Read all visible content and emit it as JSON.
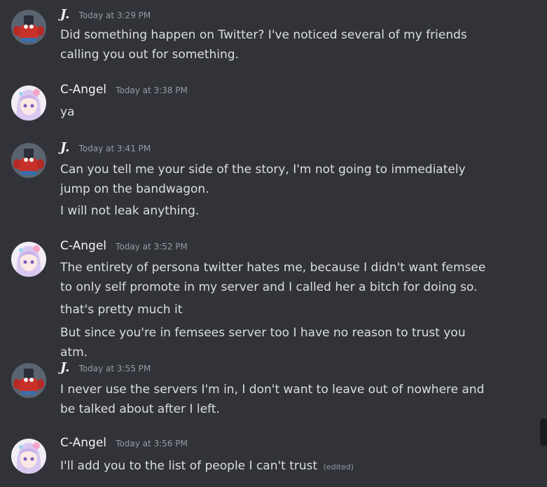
{
  "messages": [
    {
      "author": "J.",
      "time": "Today at 3:29 PM",
      "lines": [
        "Did something happen on Twitter? I've noticed several of my friends calling you out for something."
      ]
    },
    {
      "author": "C-Angel",
      "time": "Today at 3:38 PM",
      "lines": [
        "ya"
      ]
    },
    {
      "author": "J.",
      "time": "Today at 3:41 PM",
      "lines": [
        "Can you tell me your side of the story, I'm not going to immediately jump on the bandwagon.",
        "I will not leak anything."
      ]
    },
    {
      "author": "C-Angel",
      "time": "Today at 3:52 PM",
      "lines": [
        "The entirety of persona twitter hates me, because I didn't want femsee to only self promote in my server and I called her a bitch for doing so.",
        "that's pretty much it",
        "But since you're in femsees server too I have no reason to trust you atm."
      ]
    },
    {
      "author": "J.",
      "time": "Today at 3:55 PM",
      "lines": [
        "I never use the servers I'm in, I don't want to leave out of nowhere and be talked about after I left."
      ]
    },
    {
      "author": "C-Angel",
      "time": "Today at 3:56 PM",
      "lines": [
        "I'll add you to the list of people I can't trust"
      ],
      "edited": "(edited)"
    }
  ],
  "theme": {
    "background": "#313338",
    "text": "#dbdee1",
    "username": "#f2f3f5",
    "muted": "#949ba4"
  }
}
